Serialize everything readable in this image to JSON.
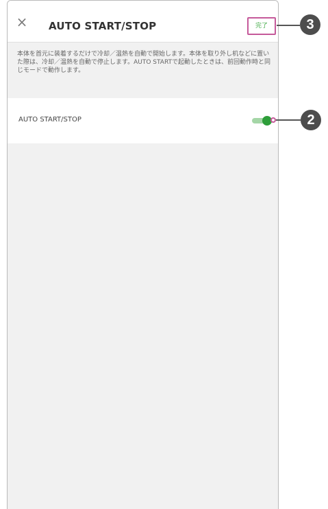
{
  "header": {
    "close_icon": "×",
    "title": "AUTO START/STOP",
    "done_label": "完了"
  },
  "description": "本体を首元に装着するだけで冷却／温熱を自動で開始します。本体を取り外し机などに置いた際は、冷却／温熱を自動で停止します。AUTO STARTで起動したときは、前回動作時と同じモードで動作します。",
  "setting": {
    "label": "AUTO START/STOP",
    "toggle_on": true
  },
  "callouts": {
    "done": "3",
    "toggle": "2"
  },
  "colors": {
    "accent": "#4caf50",
    "highlight": "#c5599a"
  }
}
